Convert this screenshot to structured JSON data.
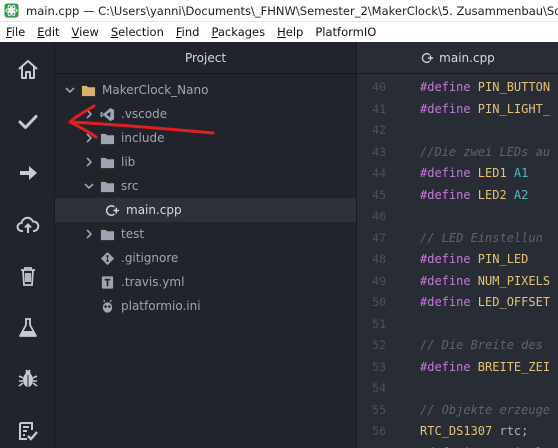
{
  "window": {
    "title": "main.cpp — C:\\Users\\yanni\\Documents\\_FHNW\\Semester_2\\MakerClock\\5. Zusammenbau\\Software"
  },
  "menu": {
    "items": [
      {
        "key": "F",
        "rest": "ile"
      },
      {
        "key": "E",
        "rest": "dit"
      },
      {
        "key": "V",
        "rest": "iew"
      },
      {
        "key": "S",
        "rest": "election"
      },
      {
        "key": "F",
        "rest": "ind"
      },
      {
        "key": "P",
        "rest": "ackages"
      },
      {
        "key": "H",
        "rest": "elp"
      },
      {
        "key": "",
        "rest": "PlatformIO"
      }
    ]
  },
  "activity_bar": {
    "icons": [
      "home-icon",
      "build-check-icon",
      "upload-arrow-icon",
      "cloud-upload-icon",
      "trash-icon",
      "test-flask-icon",
      "debug-bug-icon",
      "task-checklist-icon"
    ]
  },
  "tree": {
    "title": "Project",
    "rows": [
      {
        "label": "MakerClock_Nano",
        "kind": "project-folder",
        "chev": "down",
        "depth": 0
      },
      {
        "label": ".vscode",
        "kind": "vscode-folder",
        "chev": "right",
        "depth": 1
      },
      {
        "label": "include",
        "kind": "folder",
        "chev": "right",
        "depth": 1
      },
      {
        "label": "lib",
        "kind": "folder",
        "chev": "right",
        "depth": 1
      },
      {
        "label": "src",
        "kind": "folder",
        "chev": "down",
        "depth": 1
      },
      {
        "label": "main.cpp",
        "kind": "cpp-file",
        "chev": "",
        "depth": 2,
        "selected": true
      },
      {
        "label": "test",
        "kind": "folder",
        "chev": "right",
        "depth": 1
      },
      {
        "label": ".gitignore",
        "kind": "git-file",
        "chev": "",
        "depth": 1
      },
      {
        "label": ".travis.yml",
        "kind": "travis-file",
        "chev": "",
        "depth": 1
      },
      {
        "label": "platformio.ini",
        "kind": "pio-file",
        "chev": "",
        "depth": 1
      }
    ]
  },
  "editor": {
    "tab_label": "main.cpp",
    "lines": [
      {
        "n": "40",
        "parts": [
          [
            "kw",
            "#define "
          ],
          [
            "id",
            "PIN_BUTTON"
          ]
        ]
      },
      {
        "n": "41",
        "parts": [
          [
            "kw",
            "#define "
          ],
          [
            "id",
            "PIN_LIGHT_"
          ]
        ]
      },
      {
        "n": "42",
        "parts": []
      },
      {
        "n": "43",
        "parts": [
          [
            "cm",
            "//Die zwei LEDs au"
          ]
        ]
      },
      {
        "n": "44",
        "parts": [
          [
            "kw",
            "#define "
          ],
          [
            "id",
            "LED1 "
          ],
          [
            "num",
            "A1"
          ]
        ]
      },
      {
        "n": "45",
        "parts": [
          [
            "kw",
            "#define "
          ],
          [
            "id",
            "LED2 "
          ],
          [
            "num",
            "A2"
          ]
        ]
      },
      {
        "n": "46",
        "parts": []
      },
      {
        "n": "47",
        "parts": [
          [
            "cm",
            "// LED Einstellun"
          ]
        ]
      },
      {
        "n": "48",
        "parts": [
          [
            "kw",
            "#define "
          ],
          [
            "id",
            "PIN_LED"
          ]
        ]
      },
      {
        "n": "49",
        "parts": [
          [
            "kw",
            "#define "
          ],
          [
            "id",
            "NUM_PIXELS"
          ]
        ]
      },
      {
        "n": "50",
        "parts": [
          [
            "kw",
            "#define "
          ],
          [
            "id",
            "LED_OFFSET"
          ]
        ]
      },
      {
        "n": "51",
        "parts": []
      },
      {
        "n": "52",
        "parts": [
          [
            "cm",
            "// Die Breite des"
          ]
        ]
      },
      {
        "n": "53",
        "parts": [
          [
            "kw",
            "#define "
          ],
          [
            "id",
            "BREITE_ZEI"
          ]
        ]
      },
      {
        "n": "54",
        "parts": []
      },
      {
        "n": "55",
        "parts": [
          [
            "cm",
            "// Objekte erzeuge"
          ]
        ]
      },
      {
        "n": "56",
        "parts": [
          [
            "id",
            "RTC_DS1307 "
          ],
          [
            "pl",
            "rtc;"
          ]
        ]
      },
      {
        "n": "57",
        "parts": [
          [
            "id",
            "Adafruit_NeoPixel "
          ]
        ]
      }
    ]
  },
  "colors": {
    "annotation": "#e02020",
    "accent": "#e5c07b"
  }
}
